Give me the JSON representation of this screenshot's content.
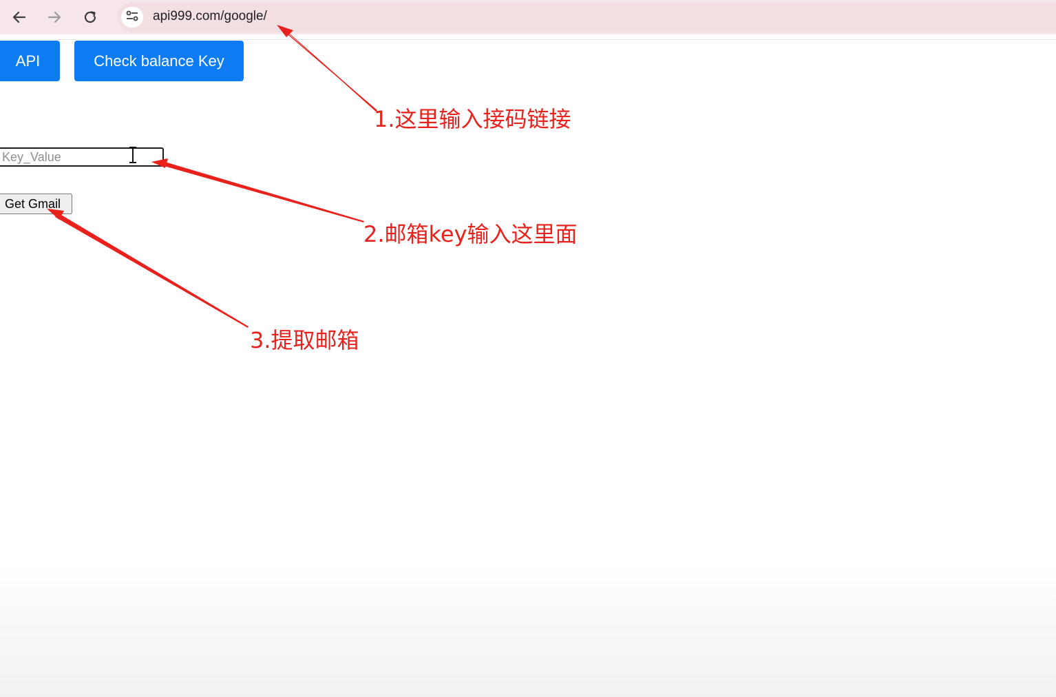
{
  "browser": {
    "url": "api999.com/google/",
    "icons": {
      "back": "arrow-left-icon",
      "forward": "arrow-right-icon",
      "reload": "reload-icon",
      "site_info": "tune-icon"
    }
  },
  "page": {
    "api_button_label": "API",
    "check_balance_button_label": "Check balance Key",
    "key_input_placeholder": "Key_Value",
    "key_input_value": "",
    "get_gmail_button_label": "Get Gmail"
  },
  "annotations": {
    "step1": "1.这里输入接码链接",
    "step2": "2.邮箱key输入这里面",
    "step3": "3.提取邮箱",
    "color": "#e8211c"
  },
  "colors": {
    "toolbar_bg": "#f8e7ea",
    "primary_button": "#0d7cf2"
  }
}
